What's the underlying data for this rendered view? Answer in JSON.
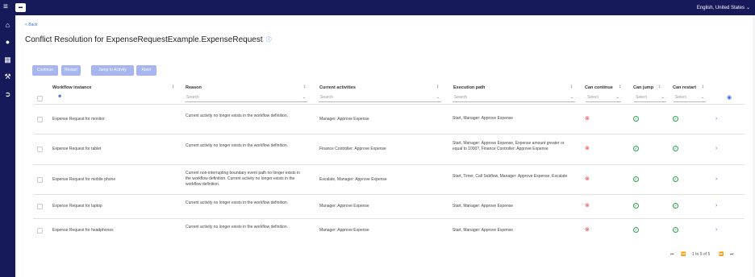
{
  "topbar": {
    "logo_text": "▬",
    "language": "English, United States",
    "language_chevron": "⌄"
  },
  "back_link": "< Back",
  "page_title": "Conflict Resolution for ExpenseRequestExample.ExpenseRequest",
  "actions": {
    "continue": "Continue",
    "restart": "Restart",
    "jump": "Jump to Activity",
    "abort": "Abort"
  },
  "columns": {
    "workflow_instance": "Workflow instance",
    "reason": "Reason",
    "current_activities": "Current activities",
    "execution_path": "Execution path",
    "can_continue": "Can continue",
    "can_jump": "Can jump",
    "can_restart": "Can restart"
  },
  "filters": {
    "reason_placeholder": "Search",
    "activities_placeholder": "Search",
    "path_placeholder": "Search",
    "continue_select": "Select",
    "jump_select": "Select",
    "restart_select": "Select"
  },
  "rows": [
    {
      "instance": "Expense Request for monitor",
      "reason": "Current activity no longer exists in the workflow definition.",
      "activities": "Manager: Approve Expense",
      "path": "Start, Manager: Approve Expense",
      "can_continue": false,
      "can_jump": true,
      "can_restart": true
    },
    {
      "instance": "Expense Request for tablet",
      "reason": "Current activity no longer exists in the workflow definition.",
      "activities": "Finance Controller: Approve Expense",
      "path": "Start, Manager: Approve Expense, Expense amount greater or equal to 1000?, Finance Controller: Approve Expense",
      "can_continue": false,
      "can_jump": true,
      "can_restart": true
    },
    {
      "instance": "Expense Request for mobile phone",
      "reason": "Current non-interrupting boundary event path no longer exists in the workflow definition. Current activity no longer exists in the workflow definition.",
      "activities": "Escalate, Manager: Approve Expense",
      "path": "Start, Timer, Call Subflow, Manager: Approve Expense, Escalate",
      "can_continue": false,
      "can_jump": true,
      "can_restart": true
    },
    {
      "instance": "Expense Request for laptop",
      "reason": "Current activity no longer exists in the workflow definition.",
      "activities": "Manager: Approve Expense",
      "path": "Start, Manager: Approve Expense",
      "can_continue": false,
      "can_jump": true,
      "can_restart": true
    },
    {
      "instance": "Expense Request for headphones",
      "reason": "Current activity no longer exists in the workflow definition.",
      "activities": "Manager: Approve Expense",
      "path": "Start, Manager: Approve Expense",
      "can_continue": false,
      "can_jump": true,
      "can_restart": true
    }
  ],
  "pagination": {
    "label": "1 to 5 of 5"
  },
  "colors": {
    "nav": "#171a5a",
    "accent": "#3a6fd8",
    "button": "#a7b6ee",
    "error": "#e0413a",
    "success": "#2ea44f"
  }
}
